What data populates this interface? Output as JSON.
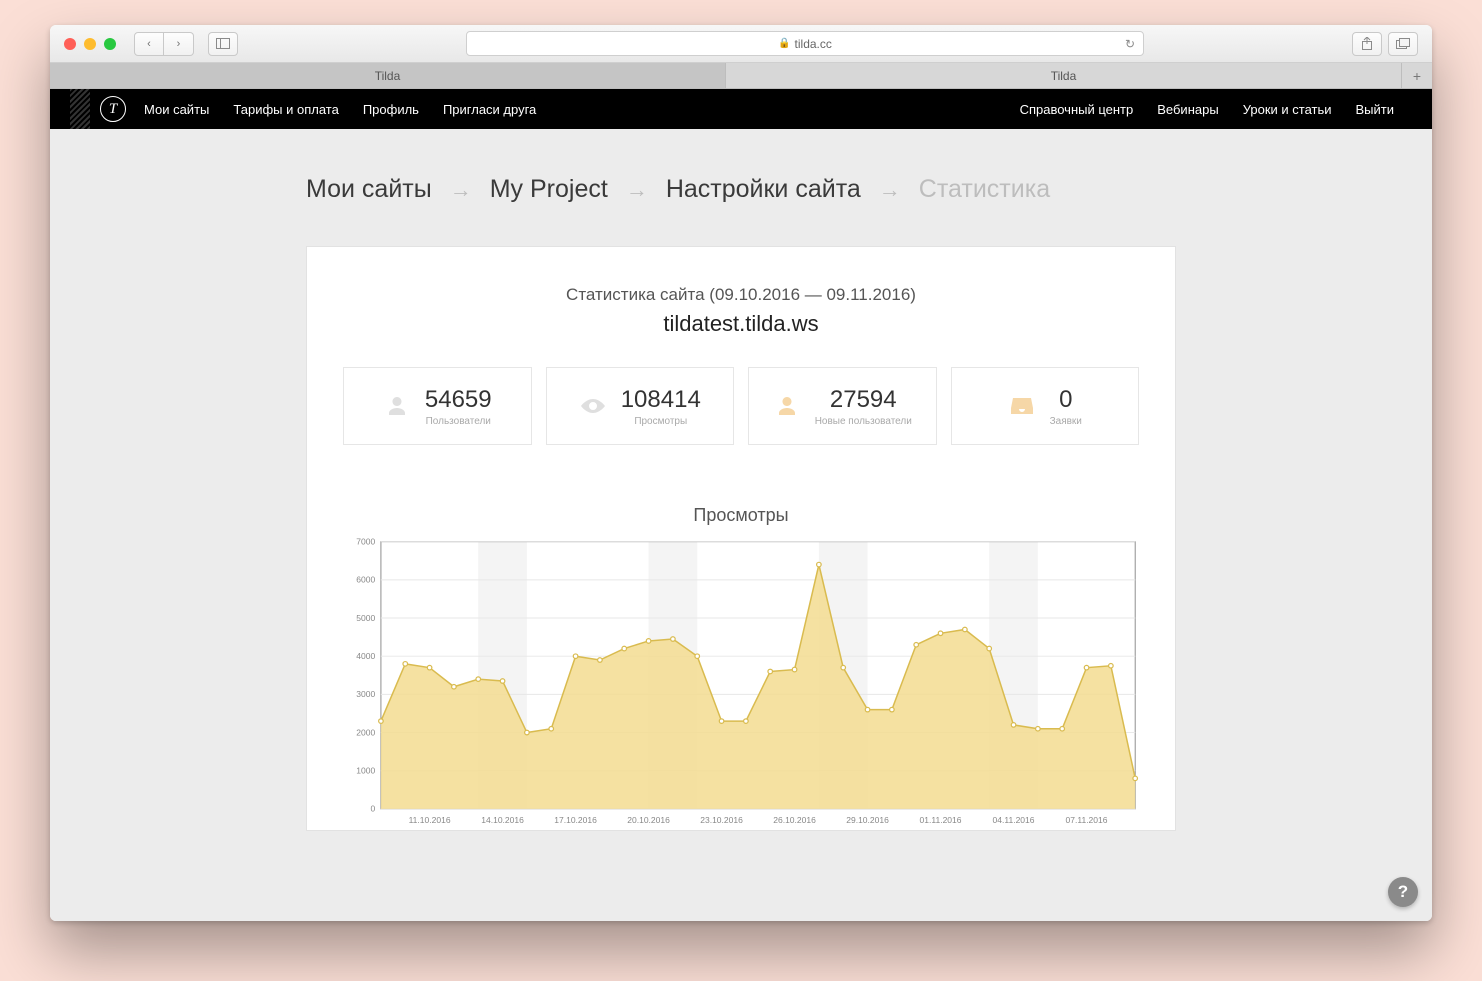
{
  "browser": {
    "url_host": "tilda.cc",
    "tabs": [
      "Tilda",
      "Tilda"
    ]
  },
  "nav": {
    "left": [
      "Мои сайты",
      "Тарифы и оплата",
      "Профиль",
      "Пригласи друга"
    ],
    "right": [
      "Справочный центр",
      "Вебинары",
      "Уроки и статьи",
      "Выйти"
    ]
  },
  "breadcrumbs": {
    "items": [
      "Мои сайты",
      "My Project",
      "Настройки сайта",
      "Статистика"
    ]
  },
  "panel": {
    "title": "Статистика сайта (09.10.2016 — 09.11.2016)",
    "domain": "tildatest.tilda.ws"
  },
  "stats": [
    {
      "value": "54659",
      "label": "Пользователи",
      "icon": "user-icon",
      "accent": false
    },
    {
      "value": "108414",
      "label": "Просмотры",
      "icon": "eye-icon",
      "accent": false
    },
    {
      "value": "27594",
      "label": "Новые пользователи",
      "icon": "user-icon",
      "accent": true
    },
    {
      "value": "0",
      "label": "Заявки",
      "icon": "inbox-icon",
      "accent": true
    }
  ],
  "chart_data": {
    "type": "area",
    "title": "Просмотры",
    "ylabel": "",
    "xlabel": "",
    "ylim": [
      0,
      7000
    ],
    "yticks": [
      0,
      1000,
      2000,
      3000,
      4000,
      5000,
      6000,
      7000
    ],
    "x_tick_labels": [
      "11.10.2016",
      "14.10.2016",
      "17.10.2016",
      "20.10.2016",
      "23.10.2016",
      "26.10.2016",
      "29.10.2016",
      "01.11.2016",
      "04.11.2016",
      "07.11.2016"
    ],
    "series": [
      {
        "name": "Просмотры",
        "color": "#e8c859",
        "fill": "#f3dc91",
        "x": [
          "09.10.2016",
          "10.10.2016",
          "11.10.2016",
          "12.10.2016",
          "13.10.2016",
          "14.10.2016",
          "15.10.2016",
          "16.10.2016",
          "17.10.2016",
          "18.10.2016",
          "19.10.2016",
          "20.10.2016",
          "21.10.2016",
          "22.10.2016",
          "23.10.2016",
          "24.10.2016",
          "25.10.2016",
          "26.10.2016",
          "27.10.2016",
          "28.10.2016",
          "29.10.2016",
          "30.10.2016",
          "31.10.2016",
          "01.11.2016",
          "02.11.2016",
          "03.11.2016",
          "04.11.2016",
          "05.11.2016",
          "06.11.2016",
          "07.11.2016",
          "08.11.2016",
          "09.11.2016"
        ],
        "values": [
          2300,
          3800,
          3700,
          3200,
          3400,
          3350,
          2000,
          2100,
          4000,
          3900,
          4200,
          4400,
          4450,
          4000,
          2300,
          2300,
          3600,
          3650,
          6400,
          3700,
          2600,
          2600,
          4300,
          4600,
          4700,
          4200,
          2200,
          2100,
          2100,
          3700,
          3750,
          800
        ]
      }
    ]
  },
  "colors": {
    "chart_stroke": "#d9bb4f",
    "chart_fill": "#f3dc91",
    "grid": "#e7e7e7",
    "axis": "#888888",
    "weekend_band": "#f4f4f4"
  },
  "help": "?"
}
